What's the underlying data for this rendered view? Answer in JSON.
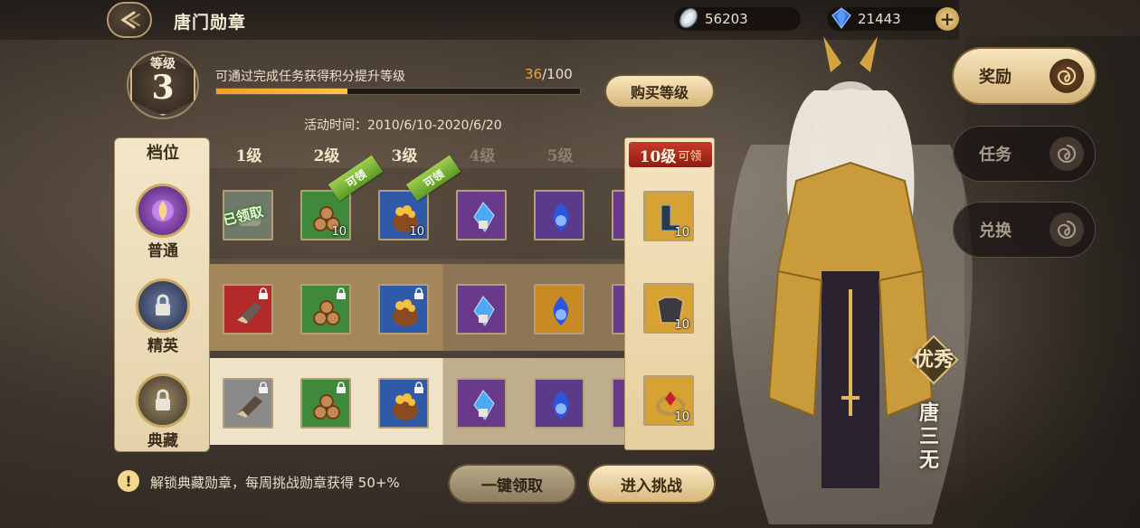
{
  "header": {
    "title": "唐门勋章",
    "silver": "56203",
    "diamond": "21443"
  },
  "level": {
    "label": "等级",
    "value": "3",
    "hint": "可通过完成任务获得积分提升等级",
    "progress_current": "36",
    "progress_total": "/100",
    "progress_fraction": 0.36,
    "buy_label": "购买等级",
    "activity_time": "活动时间：2010/6/10-2020/6/20"
  },
  "tiers": {
    "header": "档位",
    "items": [
      {
        "label": "普通"
      },
      {
        "label": "精英"
      },
      {
        "label": "典藏"
      }
    ]
  },
  "columns": [
    {
      "label": "1级",
      "active": true
    },
    {
      "label": "2级",
      "active": true
    },
    {
      "label": "3级",
      "active": true
    },
    {
      "label": "4级",
      "active": false
    },
    {
      "label": "5级",
      "active": false
    }
  ],
  "special": {
    "level_label": "10级",
    "tag": "可领"
  },
  "grid": {
    "claimed_text": "已领取",
    "ribbon_text": "可领",
    "row0_qty": [
      "",
      "10",
      "10",
      "",
      ""
    ],
    "row1_qty": [
      "",
      "",
      "",
      "",
      ""
    ],
    "row2_qty": [
      "",
      "",
      "",
      "",
      ""
    ],
    "special_qty": [
      "10",
      "10",
      "10"
    ]
  },
  "footer": {
    "tip": "解锁典藏勋章，每周挑战勋章获得 50+%",
    "claim_all": "一键领取",
    "challenge": "进入挑战"
  },
  "character": {
    "rank": "优秀",
    "name": "唐三无"
  },
  "tabs": [
    {
      "label": "奖励",
      "active": true
    },
    {
      "label": "任务",
      "active": false
    },
    {
      "label": "兑换",
      "active": false
    }
  ],
  "colors": {
    "accent_orange": "#f2a534",
    "gold": "#d6b77c",
    "ribbon_green": "#7cb83a",
    "special_red": "#b8301f"
  }
}
